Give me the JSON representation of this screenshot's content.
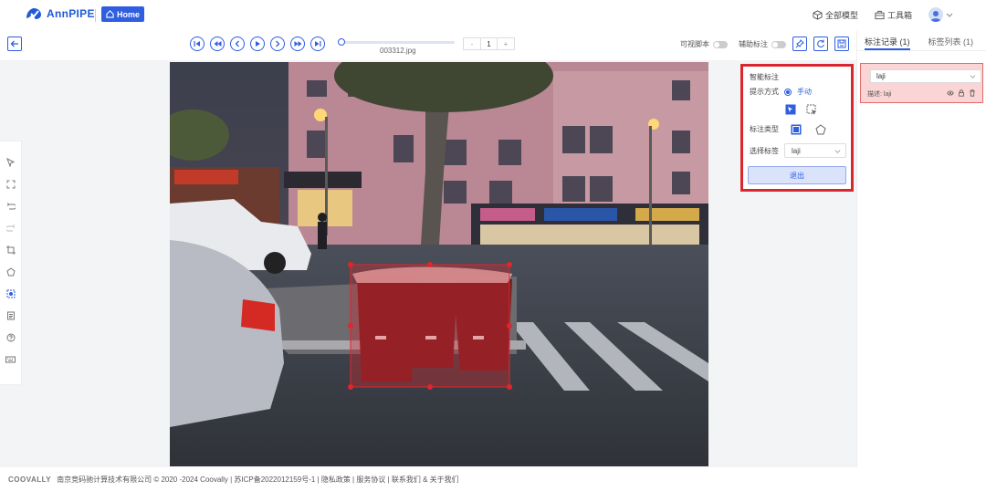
{
  "app": {
    "logo_text": "AnnPIPE",
    "home_label": "Home",
    "all_models_label": "全部模型",
    "toolbox_label": "工具箱"
  },
  "toolbar": {
    "filename": "003312.jpg",
    "page_current": "1",
    "page_prev": "-",
    "page_next": "+",
    "toggle_visible_label": "可视脚本",
    "toggle_assist_label": "辅助标注"
  },
  "sidebar": {
    "tabs": [
      {
        "label": "标注记录 (1)",
        "active": true
      },
      {
        "label": "标签列表 (1)",
        "active": false
      }
    ],
    "record": {
      "label": "laji",
      "desc": "描述: laji"
    }
  },
  "smart_panel": {
    "title": "智能标注",
    "prompt_mode_label": "提示方式",
    "prompt_mode_value": "手动",
    "annotation_type_label": "标注类型",
    "select_label_label": "选择标签",
    "select_label_value": "laji",
    "exit_label": "退出"
  },
  "footer": {
    "brand": "COOVALLY",
    "text": "南京竞码驰计算技术有限公司 © 2020 -2024 Coovally | 苏ICP备2022012159号-1 | 隐私政策 | 服务协议 | 联系我们 & 关于我们"
  },
  "colors": {
    "accent": "#2f5ee0",
    "highlight_border": "#d9282d",
    "bbox": "#e0262c"
  },
  "annotation": {
    "label": "laji"
  }
}
